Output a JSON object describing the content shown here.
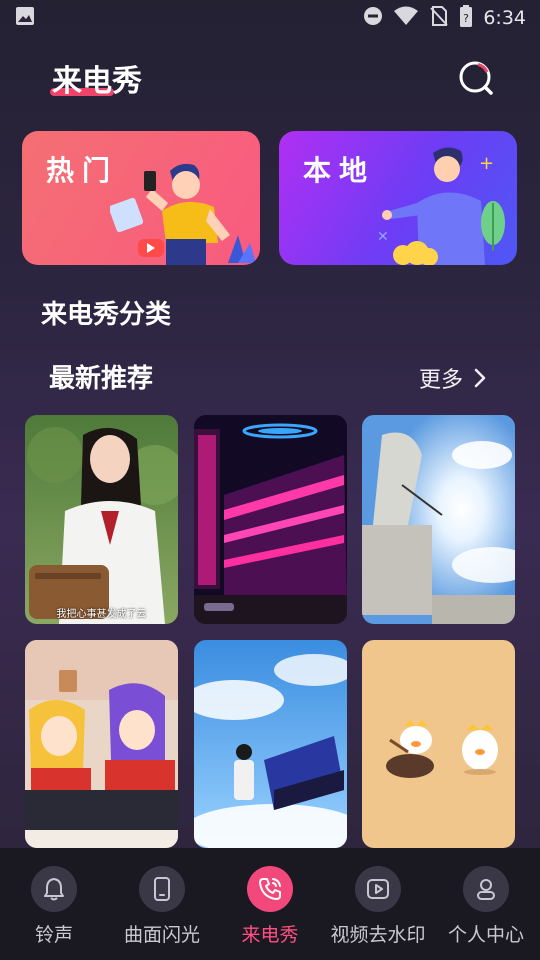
{
  "status_bar": {
    "time": "6:34",
    "icons": [
      "image-icon",
      "do-not-disturb-icon",
      "wifi-icon",
      "no-sim-icon",
      "battery-icon"
    ]
  },
  "header": {
    "title": "来电秀",
    "search_icon": "search-icon",
    "accent_color": "#f0436a"
  },
  "categories": [
    {
      "label": "热门",
      "gradient": [
        "#f46f73",
        "#f95a80"
      ]
    },
    {
      "label": "本地",
      "gradient": [
        "#b12ff3",
        "#4e58f5"
      ]
    }
  ],
  "section_title": "来电秀分类",
  "recommend": {
    "title": "最新推荐",
    "more_label": "更多",
    "items": [
      {
        "caption": "我把心事甚发成了云"
      },
      {
        "caption": ""
      },
      {
        "caption": ""
      },
      {
        "caption": ""
      },
      {
        "caption": ""
      },
      {
        "caption": ""
      }
    ]
  },
  "bottom_nav": {
    "active_index": 2,
    "items": [
      {
        "label": "铃声",
        "icon": "bell-icon"
      },
      {
        "label": "曲面闪光",
        "icon": "phone-device-icon"
      },
      {
        "label": "来电秀",
        "icon": "phone-call-icon"
      },
      {
        "label": "视频去水印",
        "icon": "play-icon"
      },
      {
        "label": "个人中心",
        "icon": "person-icon"
      }
    ]
  }
}
